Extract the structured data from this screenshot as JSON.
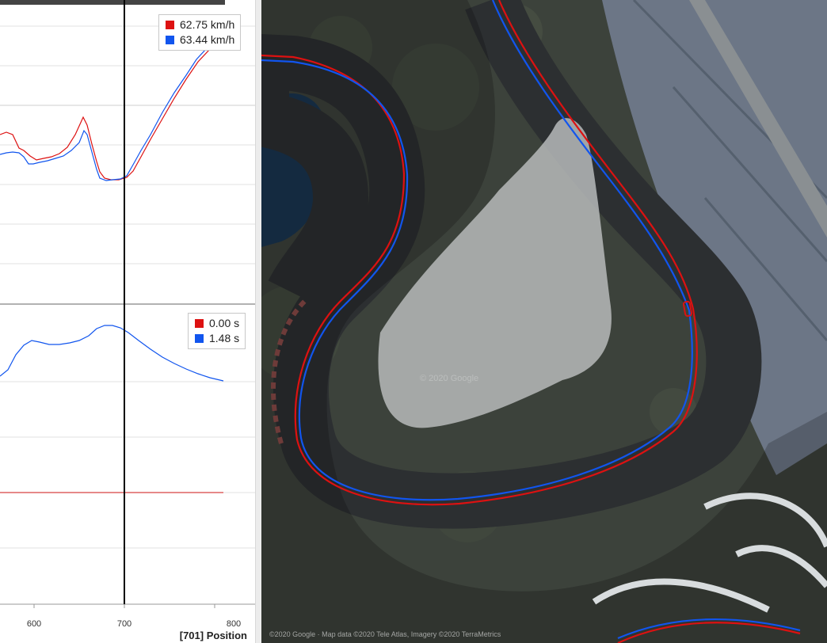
{
  "speed_chart": {
    "legend": [
      {
        "color": "#dd1111",
        "value": "62.75 km/h"
      },
      {
        "color": "#1155ee",
        "value": "63.44 km/h"
      }
    ]
  },
  "time_chart": {
    "legend": [
      {
        "color": "#dd1111",
        "value": "0.00 s"
      },
      {
        "color": "#1155ee",
        "value": "1.48 s"
      }
    ]
  },
  "x_axis": {
    "ticks": [
      "600",
      "700",
      "800"
    ],
    "position_label": "[701] Position"
  },
  "map": {
    "watermark": "© 2020 Google",
    "credit": "©2020 Google · Map data ©2020 Tele Atlas, Imagery ©2020 TerraMetrics"
  },
  "colors": {
    "lap_red": "#dd1111",
    "lap_blue": "#1155ee",
    "cursor": "#000000"
  }
}
